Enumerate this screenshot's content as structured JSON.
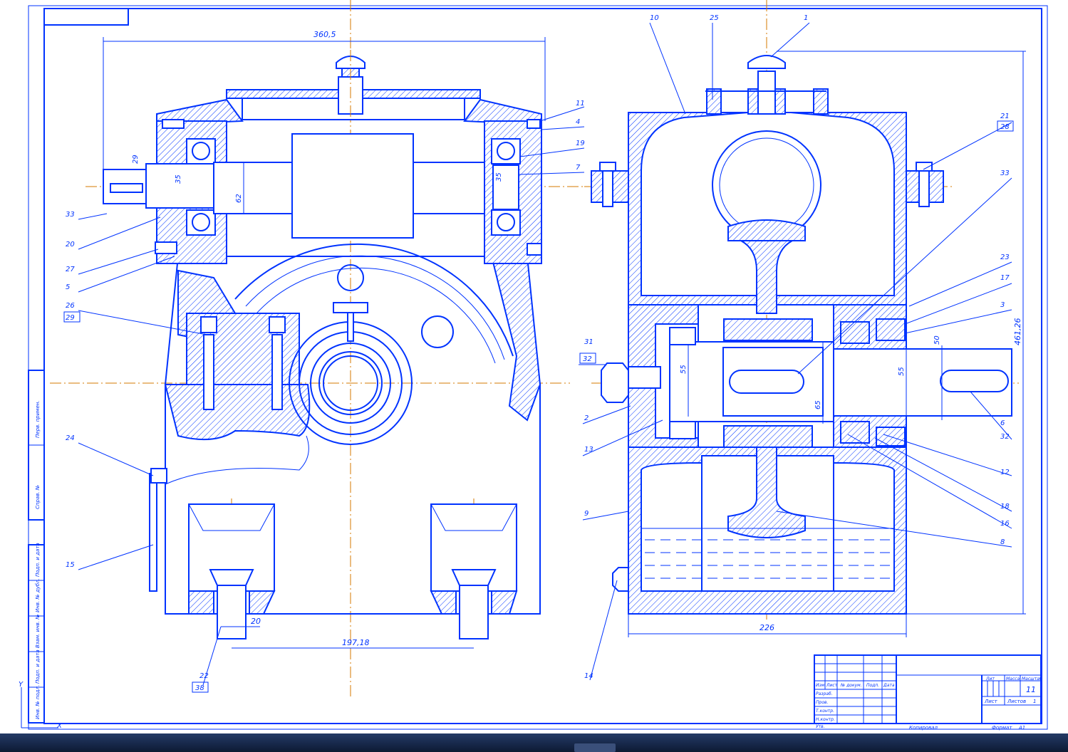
{
  "colors": {
    "line": "#0033ff",
    "axis": "#d47a00",
    "paper": "#ffffff",
    "taskbar": "#1b2d55"
  },
  "dimensions": {
    "width_total": "360,5",
    "base_centers": "197,18",
    "bolt_dia": "20",
    "shaft_29": "29",
    "shaft_35": "35",
    "shaft_62": "62",
    "shaft_35_right": "35",
    "height_total": "461,26",
    "width_226": "226",
    "shaft_55_left": "55",
    "shaft_65": "65",
    "shaft_55_right": "55",
    "shaft_50": "50"
  },
  "callouts_left": [
    "11",
    "4",
    "19",
    "7",
    "33",
    "20",
    "27",
    "5",
    "26",
    "29",
    "24",
    "15",
    "22",
    "38"
  ],
  "callouts_right": [
    "10",
    "25",
    "1",
    "21",
    "28",
    "33",
    "23",
    "17",
    "3",
    "31",
    "32",
    "2",
    "13",
    "9",
    "14",
    "6",
    "32",
    "12",
    "18",
    "16",
    "8"
  ],
  "title_block": {
    "sheet": "11",
    "headers": [
      "Лит",
      "Масса",
      "Масштаб"
    ],
    "sheet_label": "Лист",
    "sheets_label": "Листов",
    "sheets_count": "1",
    "row_labels": [
      "Изм",
      "Лист",
      "№ докум.",
      "Подп.",
      "Дата"
    ],
    "roles": [
      "Разраб.",
      "Пров.",
      "Т.контр.",
      "Н.контр.",
      "Утв."
    ],
    "copied": "Копировал",
    "format": "Формат",
    "format_value": "A1"
  },
  "side_stamp": [
    "Инв. № подл.",
    "Подп. и дата",
    "Взам. инв. №",
    "Инв. № дубл.",
    "Подп. и дата",
    "Справ. №",
    "Перв. примен."
  ],
  "ucs": {
    "y": "Y",
    "x": "X"
  }
}
